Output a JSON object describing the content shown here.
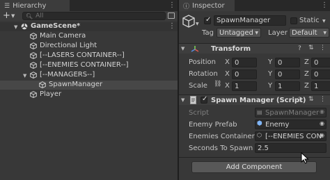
{
  "hierarchy": {
    "tab_title": "Hierarchy",
    "search_placeholder": "All",
    "add_label": "+",
    "items": [
      {
        "label": "GameScene*",
        "depth": 0,
        "type": "scene",
        "expanded": true
      },
      {
        "label": "Main Camera",
        "depth": 1,
        "type": "object"
      },
      {
        "label": "Directional Light",
        "depth": 1,
        "type": "object"
      },
      {
        "label": "[--LASERS CONTAINER--]",
        "depth": 1,
        "type": "object"
      },
      {
        "label": "[--ENEMIES CONTAINER--]",
        "depth": 1,
        "type": "object"
      },
      {
        "label": "[--MANAGERS--]",
        "depth": 1,
        "type": "object",
        "expanded": true
      },
      {
        "label": "SpawnManager",
        "depth": 2,
        "type": "object",
        "selected": true
      },
      {
        "label": "Player",
        "depth": 1,
        "type": "object"
      }
    ]
  },
  "inspector": {
    "tab_title": "Inspector",
    "object_name": "SpawnManager",
    "static_label": "Static",
    "tag_label": "Tag",
    "tag_value": "Untagged",
    "layer_label": "Layer",
    "layer_value": "Default",
    "transform": {
      "title": "Transform",
      "rows": [
        {
          "label": "Position",
          "x": "0",
          "y": "0",
          "z": "0"
        },
        {
          "label": "Rotation",
          "x": "0",
          "y": "0",
          "z": "0"
        },
        {
          "label": "Scale",
          "x": "1",
          "y": "1",
          "z": "1"
        }
      ],
      "axis_x": "X",
      "axis_y": "Y",
      "axis_z": "Z"
    },
    "script_component": {
      "title": "Spawn Manager (Script)",
      "script_label": "Script",
      "script_value": "SpawnManager",
      "enemy_prefab_label": "Enemy Prefab",
      "enemy_prefab_value": "Enemy",
      "enemies_container_label": "Enemies Container",
      "enemies_container_value": "[--ENEMIES CON",
      "seconds_label": "Seconds To Spawn",
      "seconds_value": "2.5"
    },
    "add_component_label": "Add Component"
  },
  "colors": {
    "panel": "#383838",
    "field": "#2a2a2a",
    "selection": "#474747",
    "accent_blue": "#7fb4f5"
  }
}
